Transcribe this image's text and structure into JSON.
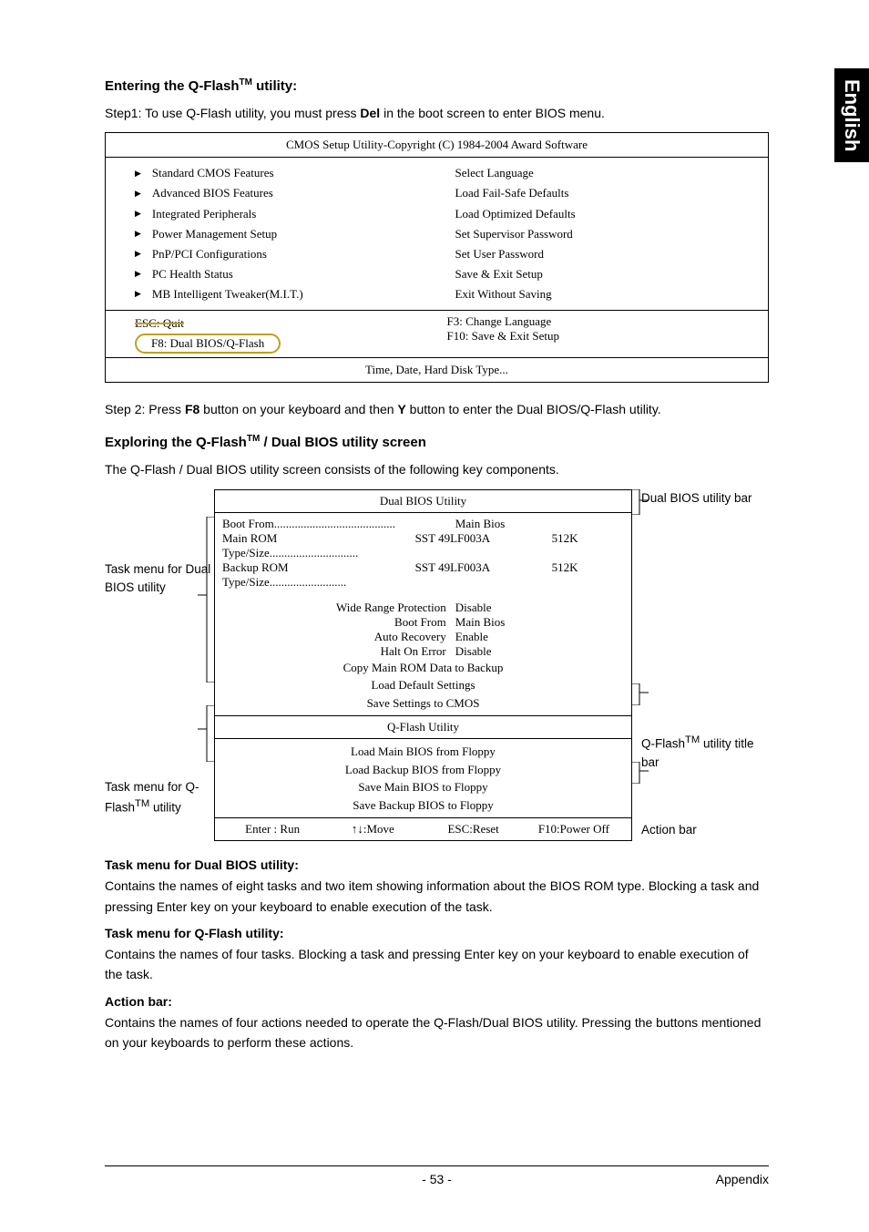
{
  "sideTab": "English",
  "section1": {
    "title_pre": "Entering the Q-Flash",
    "title_sup": "TM",
    "title_post": " utility:",
    "step1_pre": "Step1: To use Q-Flash utility, you must press ",
    "step1_bold": "Del",
    "step1_post": " in the boot screen to enter BIOS menu."
  },
  "bios": {
    "header": "CMOS Setup Utility-Copyright (C) 1984-2004 Award Software",
    "leftItems": [
      "Standard CMOS Features",
      "Advanced BIOS Features",
      "Integrated Peripherals",
      "Power Management Setup",
      "PnP/PCI Configurations",
      "PC Health Status",
      "MB Intelligent Tweaker(M.I.T.)"
    ],
    "rightItems": [
      "Select Language",
      "Load Fail-Safe Defaults",
      "Load Optimized Defaults",
      "Set Supervisor Password",
      "Set User Password",
      "Save & Exit Setup",
      "Exit Without Saving"
    ],
    "escQuit": "ESC: Quit",
    "f3": "F3: Change Language",
    "f8": "F8: Dual BIOS/Q-Flash",
    "f10": "F10: Save & Exit Setup",
    "footer2": "Time, Date, Hard Disk Type..."
  },
  "step2": {
    "pre": "Step 2: Press ",
    "b1": "F8",
    "mid": " button on your keyboard and then ",
    "b2": "Y",
    "post": " button to enter the Dual BIOS/Q-Flash utility."
  },
  "section2": {
    "title_pre": "Exploring the Q-Flash",
    "title_sup": "TM",
    "title_post": " / Dual BIOS utility screen",
    "body": "The Q-Flash / Dual BIOS utility screen consists of the following key components."
  },
  "diagram": {
    "leftLabel1": "Task menu for Dual BIOS utility",
    "leftLabel2_pre": "Task menu for Q-Flash",
    "leftLabel2_sup": "TM",
    "leftLabel2_post": " utility",
    "rightLabel1": "Dual BIOS utility bar",
    "rightLabel2_pre": "Q-Flash",
    "rightLabel2_sup": "TM",
    "rightLabel2_post": " utility title bar",
    "rightLabel3": "Action bar",
    "title1": "Dual BIOS Utility",
    "bootFromLabel": "Boot From.........................................",
    "bootFromValue": "Main Bios",
    "mainRomLabel": "Main ROM Type/Size..............................",
    "mainRomValue": "SST 49LF003A",
    "mainRomSize": "512K",
    "backupRomLabel": "Backup ROM Type/Size..........................",
    "backupRomValue": "SST 49LF003A",
    "backupRomSize": "512K",
    "settings": [
      {
        "k": "Wide Range Protection",
        "v": "Disable"
      },
      {
        "k": "Boot From",
        "v": "Main Bios"
      },
      {
        "k": "Auto Recovery",
        "v": "Enable"
      },
      {
        "k": "Halt On Error",
        "v": "Disable"
      }
    ],
    "lines1": [
      "Copy Main ROM Data to Backup",
      "Load Default Settings",
      "Save Settings to CMOS"
    ],
    "title2": "Q-Flash Utility",
    "lines2": [
      "Load Main BIOS from Floppy",
      "Load Backup BIOS from Floppy",
      "Save Main BIOS to Floppy",
      "Save Backup BIOS to Floppy"
    ],
    "actions": [
      "Enter : Run",
      "↑↓:Move",
      "ESC:Reset",
      "F10:Power Off"
    ]
  },
  "sections": {
    "s1title": "Task menu for Dual BIOS utility:",
    "s1body": "Contains the names of eight tasks and two item showing information about the BIOS ROM type. Blocking a task and pressing Enter key on your keyboard to enable execution of the task.",
    "s2title": "Task menu for Q-Flash utility:",
    "s2body": "Contains the names of four tasks. Blocking a task and pressing Enter key on your keyboard to enable execution of the task.",
    "s3title": "Action bar:",
    "s3body": "Contains the names of four actions needed to operate the Q-Flash/Dual BIOS utility. Pressing the buttons mentioned on your keyboards to perform these actions."
  },
  "footer": {
    "pageNum": "- 53 -",
    "right": "Appendix"
  }
}
